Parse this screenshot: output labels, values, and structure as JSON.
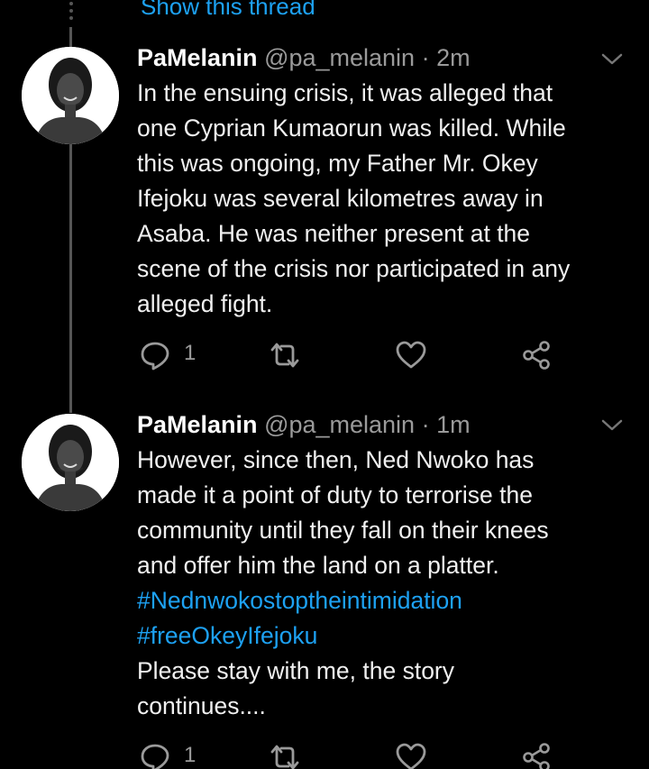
{
  "show_thread_label": "Show this thread",
  "tweets": [
    {
      "display_name": "PaMelanin",
      "handle": "@pa_melanin",
      "separator": "·",
      "time": "2m",
      "lines": [
        "In the ensuing crisis, it was alleged that",
        "one Cyprian Kumaorun was killed. While",
        "this was ongoing, my Father Mr. Okey",
        "Ifejoku was several kilometres away in",
        "Asaba. He was neither present at the",
        "scene of the crisis nor participated in any",
        "alleged fight."
      ],
      "reply_count": "1"
    },
    {
      "display_name": "PaMelanin",
      "handle": "@pa_melanin",
      "separator": "·",
      "time": "1m",
      "lines": [
        "However, since then, Ned Nwoko has",
        "made it a point of duty to terrorise the",
        "community until they fall on their knees",
        "and offer him the land on a platter."
      ],
      "hashtags": [
        "#Nednwokostoptheintimidation",
        "#freeOkeyIfejoku"
      ],
      "lines_after": [
        "Please stay with me, the story",
        "continues...."
      ],
      "reply_count": "1"
    }
  ],
  "colors": {
    "background": "#000000",
    "link": "#1da1f2",
    "muted": "#9a9a9a",
    "text": "#f0f0f0"
  },
  "icons": [
    "reply-icon",
    "retweet-icon",
    "like-icon",
    "share-icon",
    "chevron-down-icon"
  ]
}
